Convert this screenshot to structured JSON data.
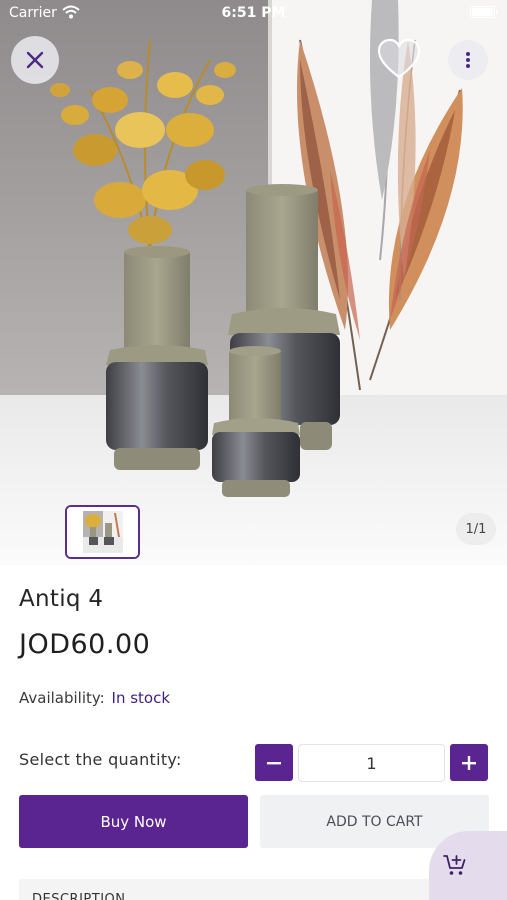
{
  "status_bar": {
    "carrier": "Carrier",
    "time": "6:51 PM"
  },
  "gallery": {
    "counter": "1/1"
  },
  "product": {
    "name": "Antiq 4",
    "price": "JOD60.00",
    "availability_label": "Availability:",
    "availability_value": "In stock"
  },
  "quantity": {
    "label": "Select the quantity:",
    "value": "1"
  },
  "actions": {
    "buy_now": "Buy Now",
    "add_to_cart": "ADD TO CART"
  },
  "sections": {
    "description": "DESCRIPTION"
  },
  "icons": {
    "close": "close-icon",
    "favorite": "heart-icon",
    "more": "more-vertical-icon",
    "minus": "minus-icon",
    "plus": "plus-icon",
    "cart": "cart-add-icon"
  },
  "colors": {
    "accent": "#5a2590",
    "stock": "#3f1f83",
    "fab_bg": "#e4dcec"
  }
}
